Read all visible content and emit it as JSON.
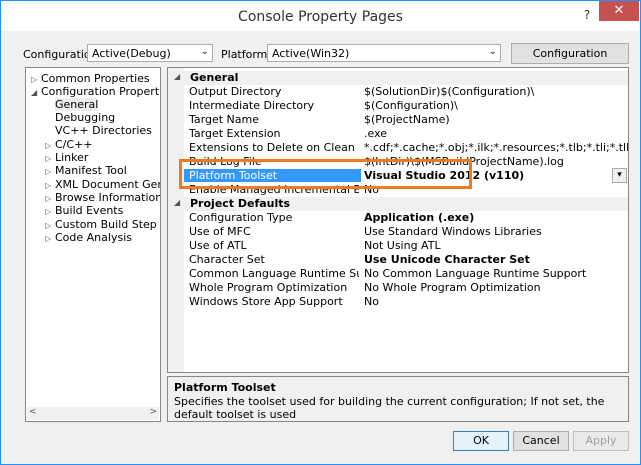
{
  "window": {
    "title": "Console Property Pages",
    "help_glyph": "?",
    "close_glyph": "✕"
  },
  "toolbar": {
    "configuration_label": "Configuration:",
    "configuration_value": "Active(Debug)",
    "platform_label": "Platform:",
    "platform_value": "Active(Win32)",
    "config_manager_label": "Configuration Manager..."
  },
  "tree": {
    "items": [
      {
        "label": "Common Properties",
        "toggle": "▷"
      },
      {
        "label": "Configuration Properties",
        "toggle": "◢"
      },
      {
        "label": "General",
        "toggle": ""
      },
      {
        "label": "Debugging",
        "toggle": ""
      },
      {
        "label": "VC++ Directories",
        "toggle": ""
      },
      {
        "label": "C/C++",
        "toggle": "▷"
      },
      {
        "label": "Linker",
        "toggle": "▷"
      },
      {
        "label": "Manifest Tool",
        "toggle": "▷"
      },
      {
        "label": "XML Document Generator",
        "toggle": "▷"
      },
      {
        "label": "Browse Information",
        "toggle": "▷"
      },
      {
        "label": "Build Events",
        "toggle": "▷"
      },
      {
        "label": "Custom Build Step",
        "toggle": "▷"
      },
      {
        "label": "Code Analysis",
        "toggle": "▷"
      }
    ],
    "scroll_left": "<",
    "scroll_right": ">"
  },
  "grid": {
    "general_header": "General",
    "general_rows": [
      {
        "name": "Output Directory",
        "value": "$(SolutionDir)$(Configuration)\\"
      },
      {
        "name": "Intermediate Directory",
        "value": "$(Configuration)\\"
      },
      {
        "name": "Target Name",
        "value": "$(ProjectName)"
      },
      {
        "name": "Target Extension",
        "value": ".exe"
      },
      {
        "name": "Extensions to Delete on Clean",
        "value": "*.cdf;*.cache;*.obj;*.ilk;*.resources;*.tlb;*.tli;*.tlh;*.tmp;*.rsp;*.pgc;*.pgd"
      },
      {
        "name": "Build Log File",
        "value": "$(IntDir)\\$(MSBuildProjectName).log"
      },
      {
        "name": "Platform Toolset",
        "value": "Visual Studio 2012 (v110)"
      },
      {
        "name": "Enable Managed Incremental Build",
        "value": "No"
      }
    ],
    "defaults_header": "Project Defaults",
    "defaults_rows": [
      {
        "name": "Configuration Type",
        "value": "Application (.exe)"
      },
      {
        "name": "Use of MFC",
        "value": "Use Standard Windows Libraries"
      },
      {
        "name": "Use of ATL",
        "value": "Not Using ATL"
      },
      {
        "name": "Character Set",
        "value": "Use Unicode Character Set"
      },
      {
        "name": "Common Language Runtime Support",
        "value": "No Common Language Runtime Support"
      },
      {
        "name": "Whole Program Optimization",
        "value": "No Whole Program Optimization"
      },
      {
        "name": "Windows Store App Support",
        "value": "No"
      }
    ],
    "dropdown_glyph": "▾"
  },
  "description": {
    "title": "Platform Toolset",
    "text": "Specifies the toolset used for building the current configuration; If not set, the default toolset is used"
  },
  "buttons": {
    "ok": "OK",
    "cancel": "Cancel",
    "apply": "Apply"
  },
  "colors": {
    "highlight": "#f07a1e",
    "selection": "#3399ff",
    "close": "#c75050"
  }
}
